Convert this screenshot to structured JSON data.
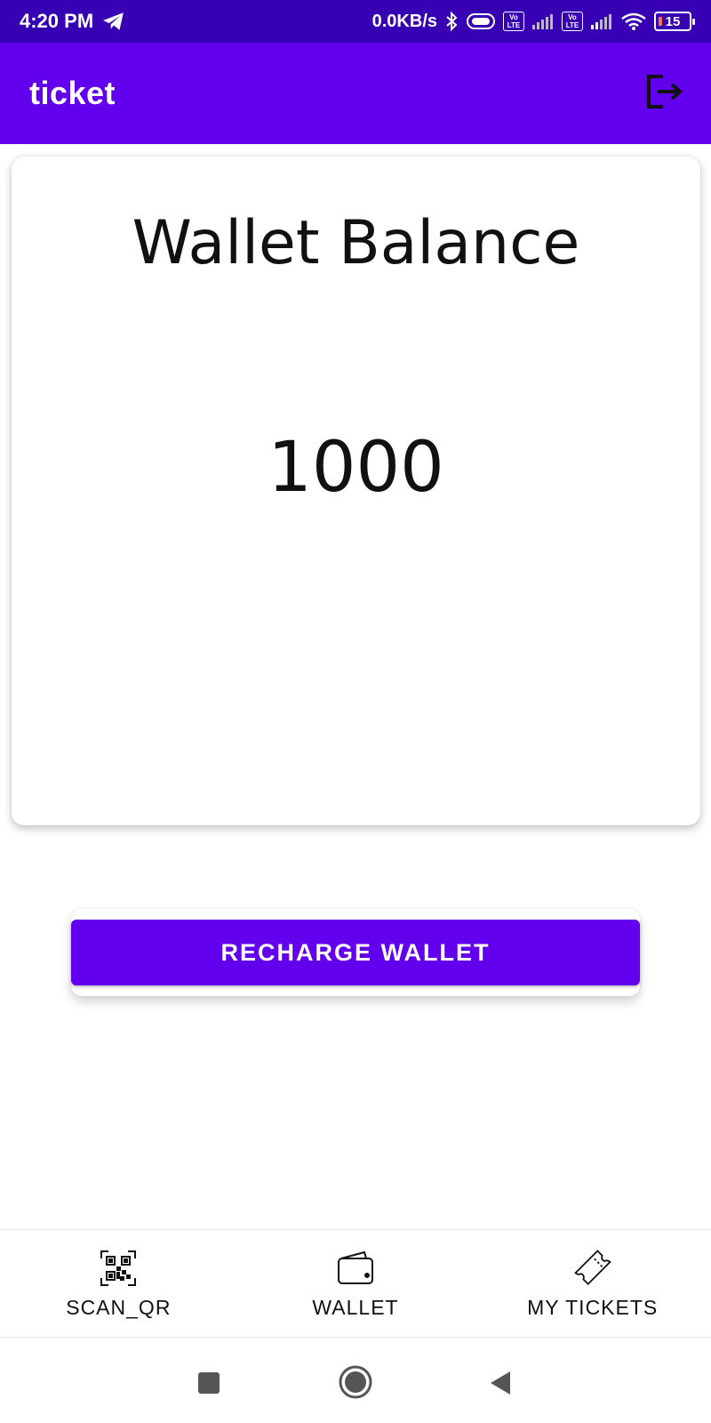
{
  "status_bar": {
    "time": "4:20 PM",
    "network_speed": "0.0KB/s",
    "volte_label_top": "Vo",
    "volte_label_bottom": "LTE",
    "battery_level": "15",
    "icons": [
      "telegram-icon",
      "bluetooth-icon",
      "data-saver-icon",
      "volte-icon",
      "signal-icon",
      "wifi-icon",
      "battery-icon"
    ]
  },
  "app_bar": {
    "title": "ticket",
    "logout_icon": "logout-icon"
  },
  "wallet_card": {
    "title": "Wallet Balance",
    "amount": "1000"
  },
  "recharge_button": {
    "label": "RECHARGE WALLET"
  },
  "bottom_nav": {
    "items": [
      {
        "label": "SCAN_QR",
        "icon": "qr-code-icon"
      },
      {
        "label": "WALLET",
        "icon": "wallet-icon"
      },
      {
        "label": "MY TICKETS",
        "icon": "ticket-icon"
      }
    ]
  },
  "system_nav": {
    "icons": [
      "recent-apps-icon",
      "home-icon",
      "back-icon"
    ]
  },
  "colors": {
    "primary": "#6200ee",
    "primary_dark": "#3700b3",
    "text": "#111111",
    "background": "#ffffff"
  }
}
